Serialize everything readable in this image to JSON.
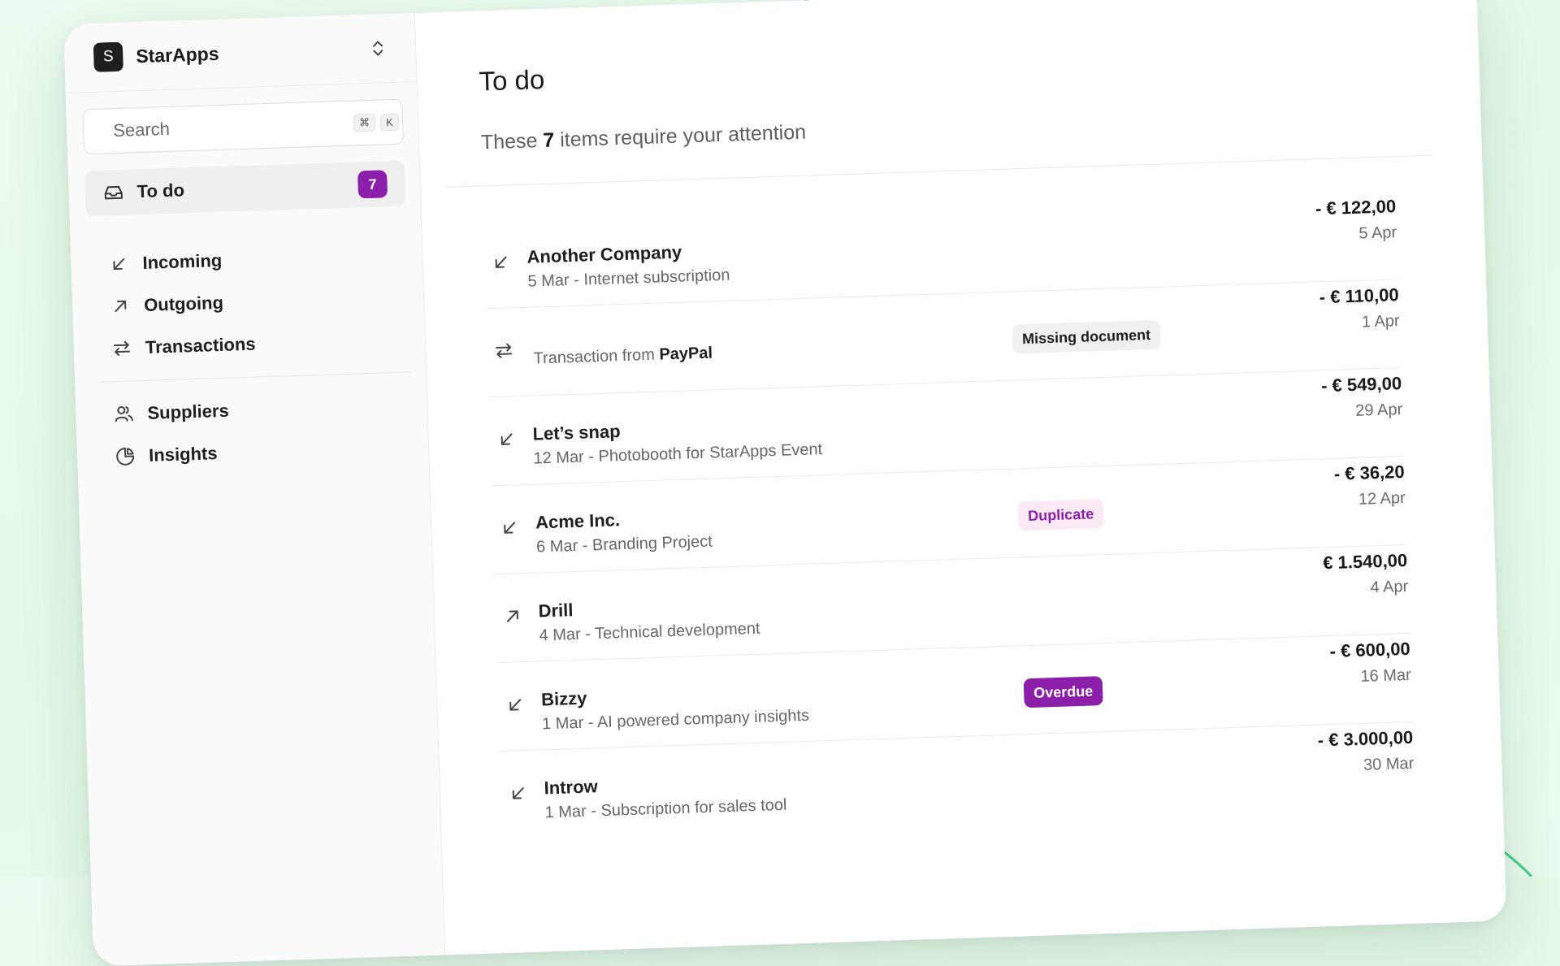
{
  "workspace": {
    "avatar_letter": "S",
    "name": "StarApps"
  },
  "search": {
    "placeholder": "Search",
    "shortcut_cmd": "⌘",
    "shortcut_key": "K"
  },
  "nav": {
    "todo": {
      "label": "To do",
      "count": "7"
    },
    "items": [
      {
        "label": "Incoming",
        "icon": "arrow-down-left-icon"
      },
      {
        "label": "Outgoing",
        "icon": "arrow-up-right-icon"
      },
      {
        "label": "Transactions",
        "icon": "arrows-swap-icon"
      }
    ],
    "secondary": [
      {
        "label": "Suppliers",
        "icon": "users-icon"
      },
      {
        "label": "Insights",
        "icon": "pie-chart-icon"
      }
    ]
  },
  "main": {
    "title": "To do",
    "subtitle_prefix": "These ",
    "subtitle_count": "7",
    "subtitle_suffix": " items require your attention",
    "items": [
      {
        "type": "incoming",
        "title": "Another Company",
        "subtitle": "5 Mar - Internet subscription",
        "amount": "- € 122,00",
        "date": "5 Apr"
      },
      {
        "type": "transaction",
        "prefix": "Transaction from ",
        "source": "PayPal",
        "tag": "Missing document",
        "amount": "- € 110,00",
        "date": "1 Apr"
      },
      {
        "type": "incoming",
        "title": "Let’s snap",
        "subtitle": "12 Mar - Photobooth for StarApps Event",
        "amount": "- € 549,00",
        "date": "29 Apr"
      },
      {
        "type": "incoming",
        "title": "Acme Inc.",
        "subtitle": "6 Mar - Branding Project",
        "tag": "Duplicate",
        "amount": "- € 36,20",
        "date": "12 Apr"
      },
      {
        "type": "outgoing",
        "title": "Drill",
        "subtitle": "4 Mar - Technical development",
        "amount": "€ 1.540,00",
        "date": "4 Apr"
      },
      {
        "type": "incoming",
        "title": "Bizzy",
        "subtitle": "1 Mar - AI powered company insights",
        "tag": "Overdue",
        "amount": "- € 600,00",
        "date": "16 Mar"
      },
      {
        "type": "incoming",
        "title": "Introw",
        "subtitle": "1 Mar - Subscription for sales tool",
        "amount": "- € 3.000,00",
        "date": "30 Mar"
      }
    ]
  },
  "colors": {
    "accent": "#8b1fa9",
    "background": "#e6faea",
    "curve": "#3fd08a"
  }
}
